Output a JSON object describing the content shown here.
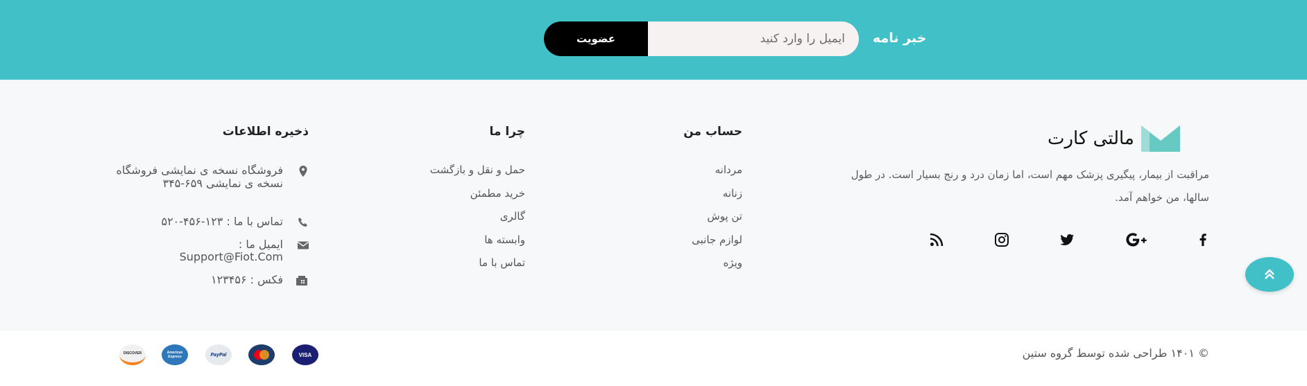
{
  "newsletter": {
    "title": "خبر نامه",
    "input_placeholder": "ایمیل را وارد کنید",
    "subscribe_label": "عضویت"
  },
  "brand": {
    "name": "مالتی کارت",
    "description": "مراقبت از بیمار، پیگیری پزشک مهم است، اما زمان درد و رنج بسیار است. در طول سالها، من خواهم آمد."
  },
  "social_icons": [
    "facebook-icon",
    "google-plus-icon",
    "twitter-icon",
    "instagram-icon",
    "rss-icon"
  ],
  "my_account": {
    "title": "حساب من",
    "links": [
      "مردانه",
      "زنانه",
      "تن پوش",
      "لوازم جانبی",
      "ویژه"
    ]
  },
  "why_us": {
    "title": "چرا ما",
    "links": [
      "حمل و نقل و بازگشت",
      "خرید مطمئن",
      "گالری",
      "وابسته ها",
      "تماس با ما"
    ]
  },
  "store_info": {
    "title": "ذخیره اطلاعات",
    "address": "فروشگاه نسخه ی نمایشی فروشگاه نسخه ی نمایشی ۶۵۹-۳۴۵",
    "phone": "تماس با ما : ۱۲۳-۴۵۶-۵۲۰",
    "email_label": "ایمیل ما :",
    "email": "Support@Fiot.Com",
    "fax": "فکس : ۱۲۳۴۵۶"
  },
  "copyright": "© ۱۴۰۱ طراحی شده توسط گروه ستین",
  "payment_methods": [
    {
      "name": "VISA",
      "icon": "visa-icon"
    },
    {
      "name": "MasterCard",
      "icon": "mastercard-icon"
    },
    {
      "name": "PayPal",
      "icon": "paypal-icon"
    },
    {
      "name": "American Express",
      "icon": "amex-icon"
    },
    {
      "name": "DISCOVER",
      "icon": "discover-icon"
    }
  ],
  "colors": {
    "accent": "#41c0c8",
    "footer_bg": "#f7f8f9",
    "button_bg": "#000000"
  }
}
